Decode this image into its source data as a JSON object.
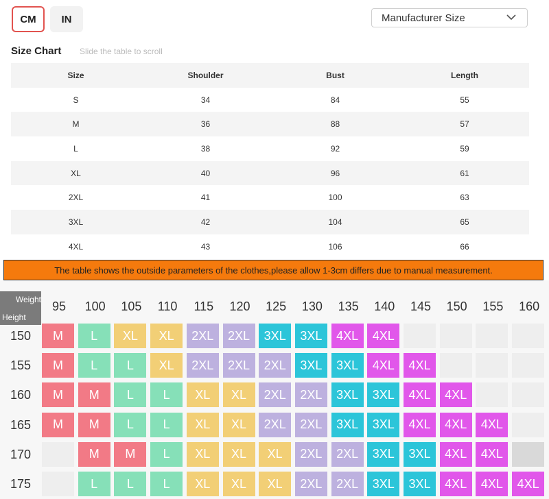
{
  "units": {
    "cm": "CM",
    "in": "IN"
  },
  "size_select": {
    "value": "Manufacturer Size"
  },
  "chart": {
    "title": "Size Chart",
    "hint": "Slide the table to scroll"
  },
  "table": {
    "headers": [
      "Size",
      "Shoulder",
      "Bust",
      "Length"
    ],
    "rows": [
      [
        "S",
        "34",
        "84",
        "55"
      ],
      [
        "M",
        "36",
        "88",
        "57"
      ],
      [
        "L",
        "38",
        "92",
        "59"
      ],
      [
        "XL",
        "40",
        "96",
        "61"
      ],
      [
        "2XL",
        "41",
        "100",
        "63"
      ],
      [
        "3XL",
        "42",
        "104",
        "65"
      ],
      [
        "4XL",
        "43",
        "106",
        "66"
      ]
    ]
  },
  "notice": "The table shows the outside parameters of the clothes,please allow 1-3cm differs due to manual measurement.",
  "grid": {
    "corner_weight": "Weight",
    "corner_height": "Height",
    "weights": [
      "95",
      "100",
      "105",
      "110",
      "115",
      "120",
      "125",
      "130",
      "135",
      "140",
      "145",
      "150",
      "155",
      "160"
    ],
    "heights": [
      "150",
      "155",
      "160",
      "165",
      "170",
      "175"
    ],
    "sizes": [
      [
        "M",
        "L",
        "XL",
        "XL",
        "2XL",
        "2XL",
        "3XL",
        "3XL",
        "4XL",
        "4XL",
        "",
        "",
        "",
        ""
      ],
      [
        "M",
        "L",
        "L",
        "XL",
        "2XL",
        "2XL",
        "2XL",
        "3XL",
        "3XL",
        "4XL",
        "4XL",
        "",
        "",
        ""
      ],
      [
        "M",
        "M",
        "L",
        "L",
        "XL",
        "XL",
        "2XL",
        "2XL",
        "3XL",
        "3XL",
        "4XL",
        "4XL",
        "",
        ""
      ],
      [
        "M",
        "M",
        "L",
        "L",
        "XL",
        "XL",
        "2XL",
        "2XL",
        "3XL",
        "3XL",
        "4XL",
        "4XL",
        "4XL",
        ""
      ],
      [
        "",
        "M",
        "M",
        "L",
        "XL",
        "XL",
        "XL",
        "2XL",
        "2XL",
        "3XL",
        "3XL",
        "4XL",
        "4XL",
        ""
      ],
      [
        "",
        "L",
        "L",
        "L",
        "XL",
        "XL",
        "XL",
        "2XL",
        "2XL",
        "3XL",
        "3XL",
        "4XL",
        "4XL",
        "4XL"
      ]
    ]
  },
  "colors": {
    "accent_border": "#e2534f",
    "notice_bg": "#f57a0d",
    "M": "#f27a86",
    "L": "#86e0b8",
    "XL": "#f2cf76",
    "2XL": "#bdb1df",
    "3XL": "#2cc5d9",
    "4XL": "#e157ea"
  },
  "icons": {
    "select_chevron": "chevron-down-icon"
  }
}
